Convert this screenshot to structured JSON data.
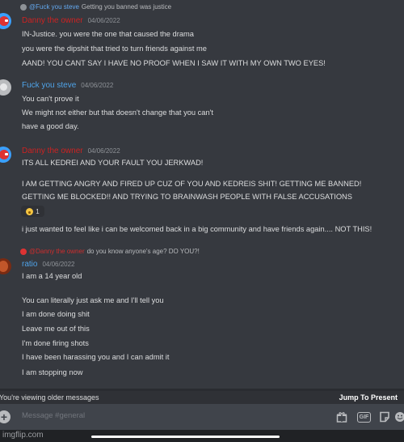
{
  "messages": [
    {
      "reply": {
        "name": "@Fuck you steve",
        "text": "Getting you banned was justice"
      },
      "author": "Danny the owner",
      "date": "04/06/2022",
      "lines": [
        "IN-Justice. you were the one that caused the drama",
        "you were the dipshit that tried to turn friends against me",
        "AAND! YOU CANT SAY I HAVE NO PROOF WHEN I SAW IT WITH MY OWN TWO EYES!"
      ]
    },
    {
      "author": "Fuck you steve",
      "date": "04/06/2022",
      "lines": [
        "You can't prove it",
        "We might not either but that doesn't change that you can't",
        "have a good day."
      ]
    },
    {
      "author": "Danny the owner",
      "date": "04/06/2022",
      "lines": [
        "ITS ALL KEDREI AND YOUR FAULT YOU JERKWAD!",
        "I AM GETTING ANGRY AND FIRED UP CUZ OF YOU AND KEDREIS SHIT! GETTING ME BANNED!",
        "GETTING ME BLOCKED!! AND TRYING TO BRAINWASH PEOPLE WITH FALSE ACCUSATIONS",
        "i just wanted to feel like i can be welcomed back in a big community and have friends again.... NOT THIS!"
      ],
      "reaction_count": "1"
    },
    {
      "reply": {
        "name": "@Danny the owner",
        "text": "do you know anyone's age? DO YOU?!"
      },
      "author": "ratio",
      "date": "04/06/2022",
      "lines": [
        "I am a 14 year old",
        "You can literally just ask me and I'll tell you",
        "I am done doing shit",
        "Leave me out of this",
        "I'm done firing shots",
        "I have been harassing you and I can admit it",
        "I am stopping now"
      ]
    }
  ],
  "banner": {
    "text": "You're viewing older messages",
    "action": "Jump To Present"
  },
  "composer": {
    "placeholder": "Message #general",
    "plus": "+",
    "gif": "GIF"
  },
  "watermark": "imgflip.com",
  "icons": [
    "gift-icon",
    "gif-icon",
    "sticker-icon",
    "emoji-icon"
  ],
  "colors": {
    "background": "#36393f",
    "composer": "#40444b",
    "red_name": "#cc2222",
    "blue_name": "#4fa3e8"
  }
}
